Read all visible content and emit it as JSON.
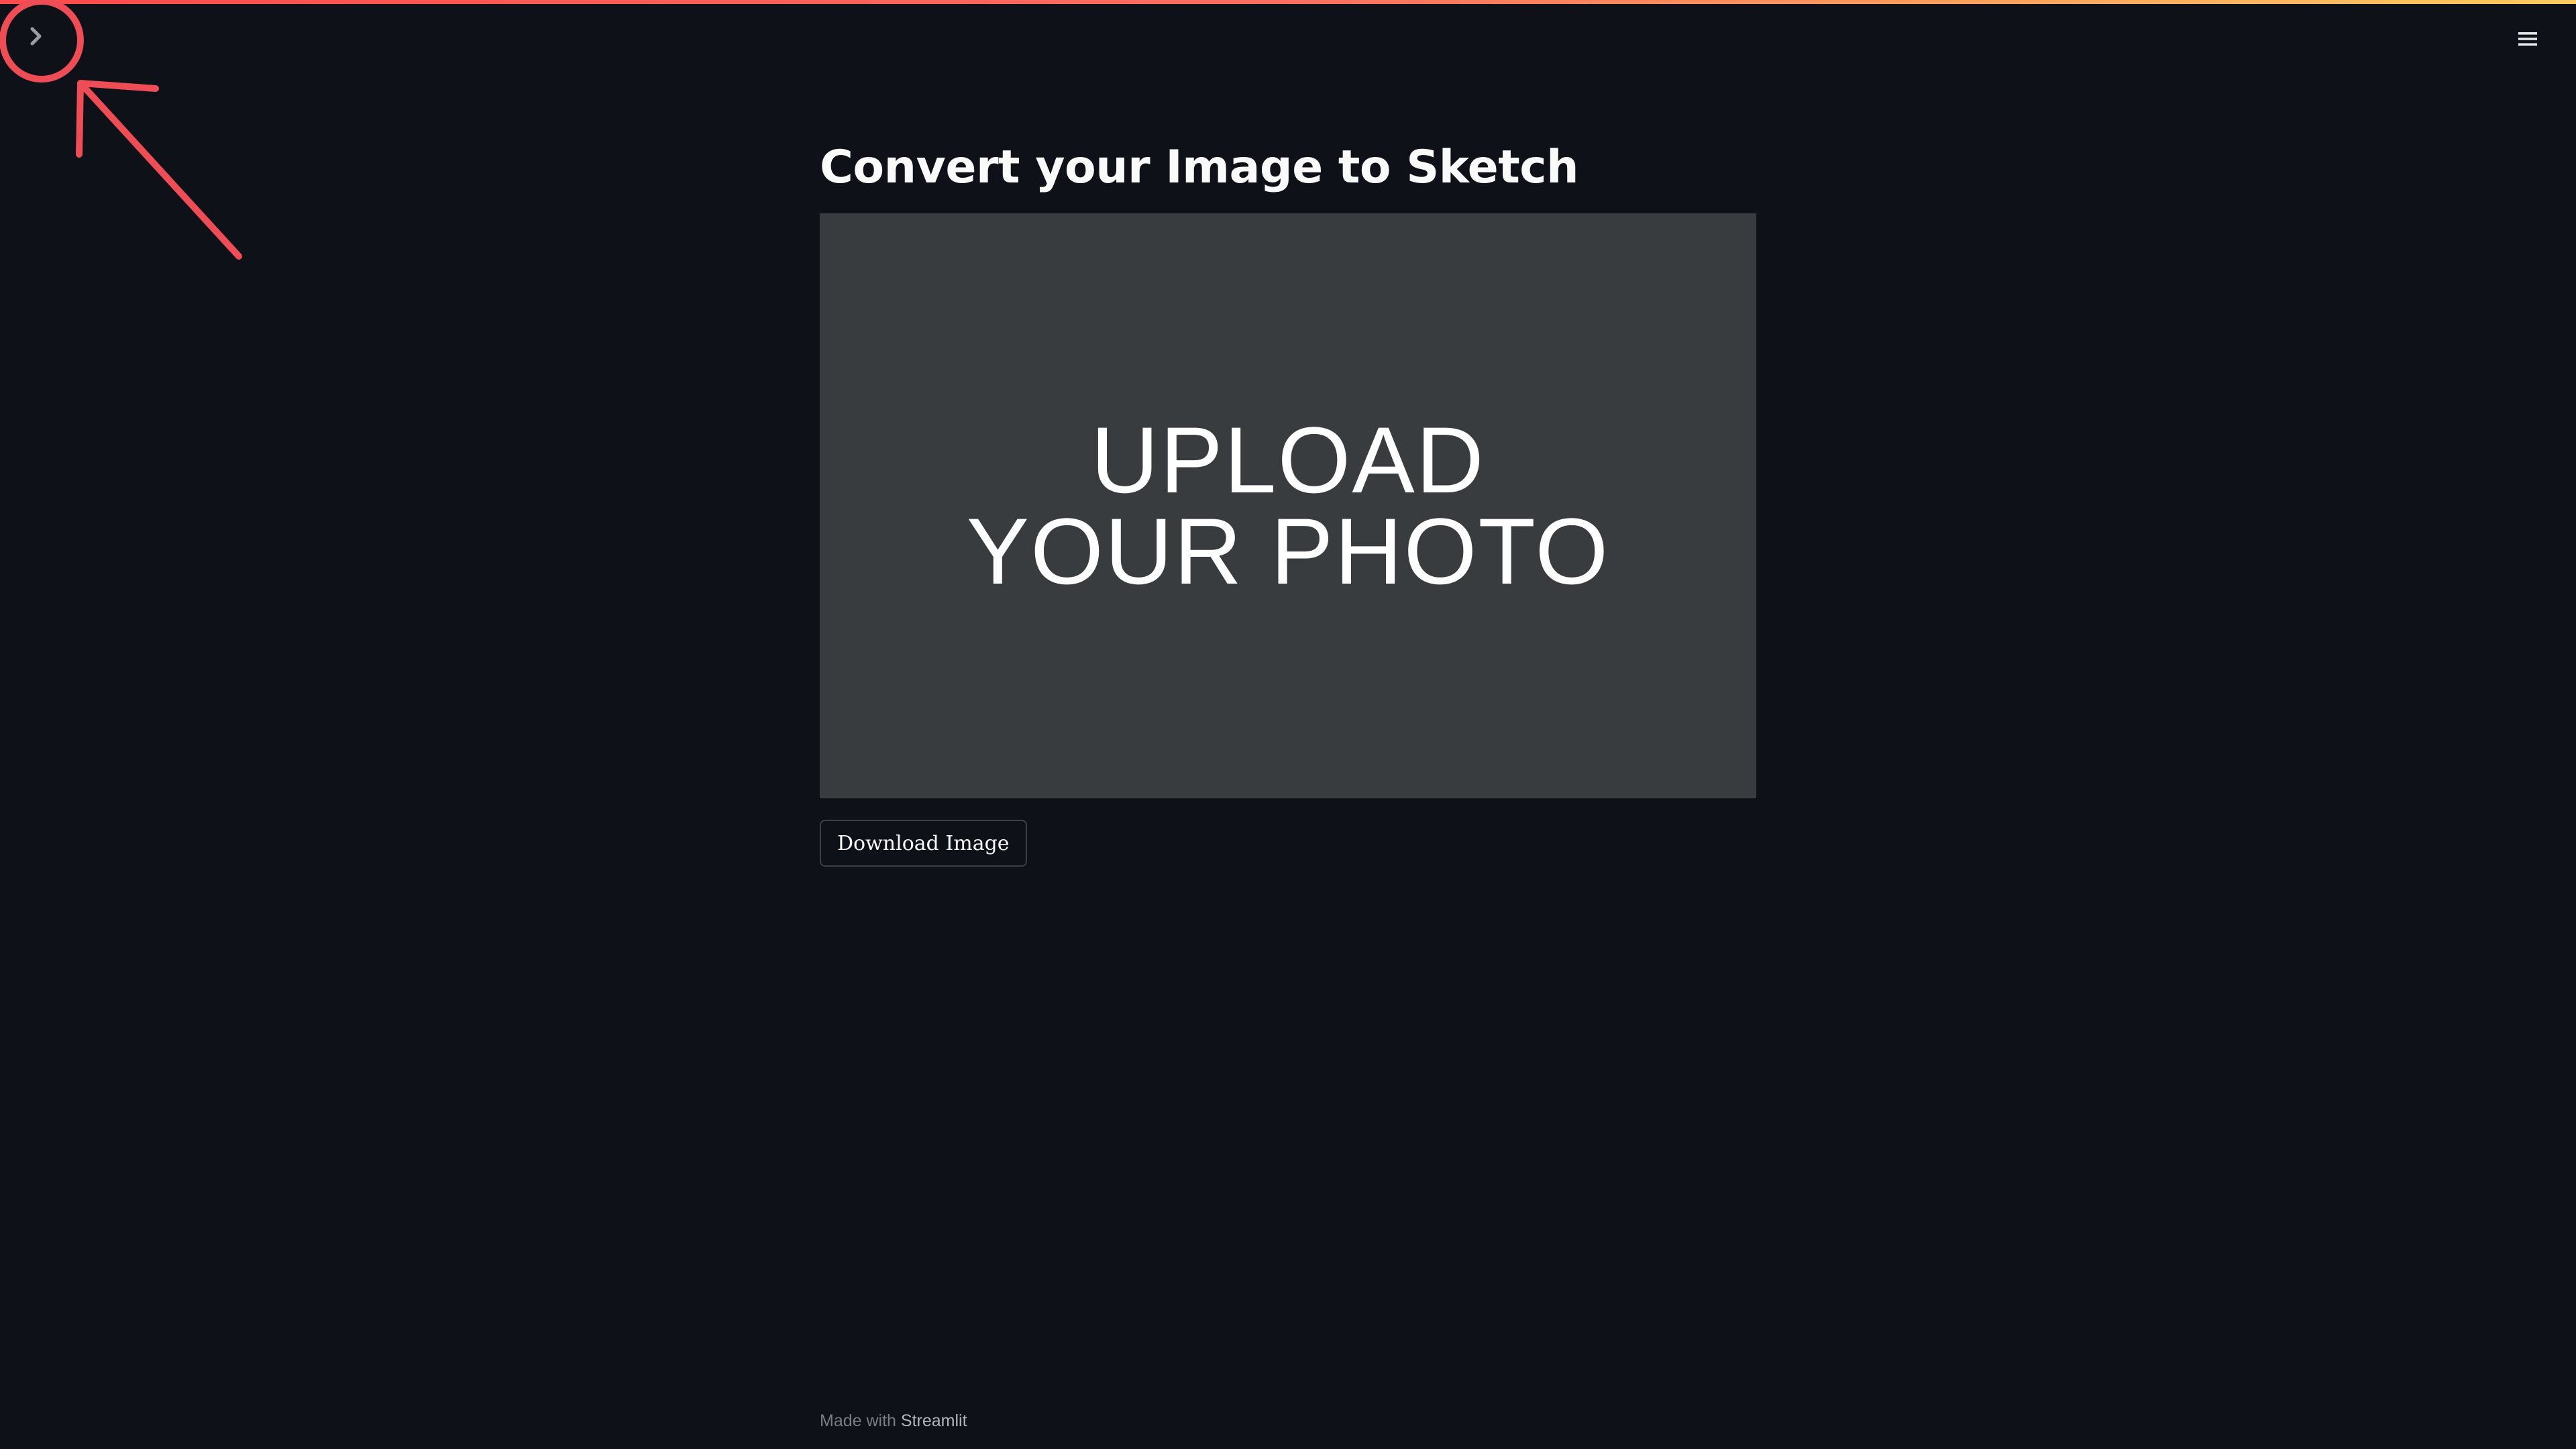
{
  "app": {
    "accent_gradient": [
      "#ff4b4b",
      "#ff6f5e",
      "#fdcb5b"
    ],
    "background_color": "#0e1117"
  },
  "header": {
    "sidebar_toggle_icon": "chevron-right-icon",
    "menu_icon": "hamburger-menu-icon"
  },
  "annotation": {
    "color": "#ee4d55",
    "shapes": [
      "circle",
      "arrow"
    ]
  },
  "main": {
    "title": "Convert your Image to Sketch",
    "image": {
      "line1": "UPLOAD",
      "line2": "YOUR PHOTO",
      "background_color": "#393c3f"
    },
    "download_label": "Download Image"
  },
  "footer": {
    "prefix": "Made with ",
    "brand": "Streamlit"
  }
}
